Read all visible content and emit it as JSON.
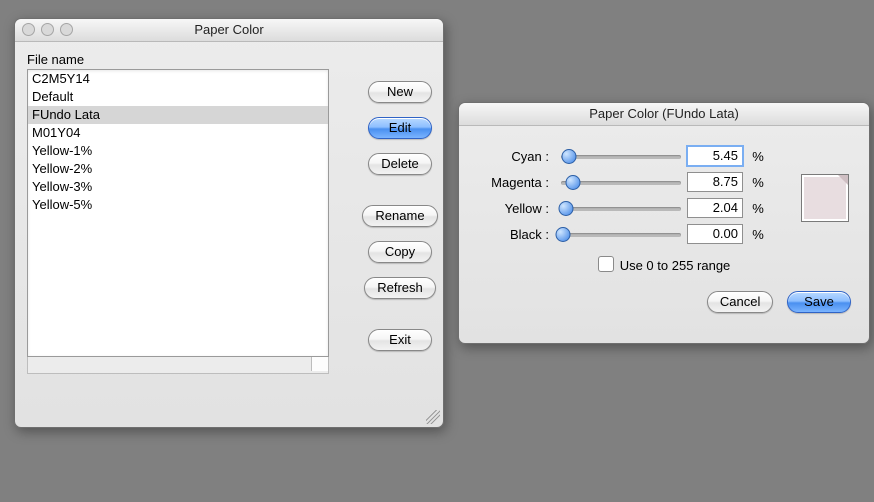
{
  "main_window": {
    "title": "Paper Color",
    "file_list_label": "File name",
    "items": [
      "C2M5Y14",
      "Default",
      "FUndo Lata",
      "M01Y04",
      "Yellow-1%",
      "Yellow-2%",
      "Yellow-3%",
      "Yellow-5%"
    ],
    "selected_index": 2,
    "buttons": {
      "new": "New",
      "edit": "Edit",
      "delete": "Delete",
      "rename": "Rename",
      "copy": "Copy",
      "refresh": "Refresh",
      "exit": "Exit"
    }
  },
  "edit_window": {
    "title": "Paper Color (FUndo Lata)",
    "channels": {
      "cyan_label": "Cyan :",
      "magenta_label": "Magenta :",
      "yellow_label": "Yellow :",
      "black_label": "Black :",
      "cyan_value": "5.45",
      "magenta_value": "8.75",
      "yellow_value": "2.04",
      "black_value": "0.00",
      "percent": "%"
    },
    "range_checkbox_label": "Use 0 to 255 range",
    "range_checked": false,
    "buttons": {
      "cancel": "Cancel",
      "save": "Save"
    },
    "swatch_color": "#e8dde0"
  }
}
